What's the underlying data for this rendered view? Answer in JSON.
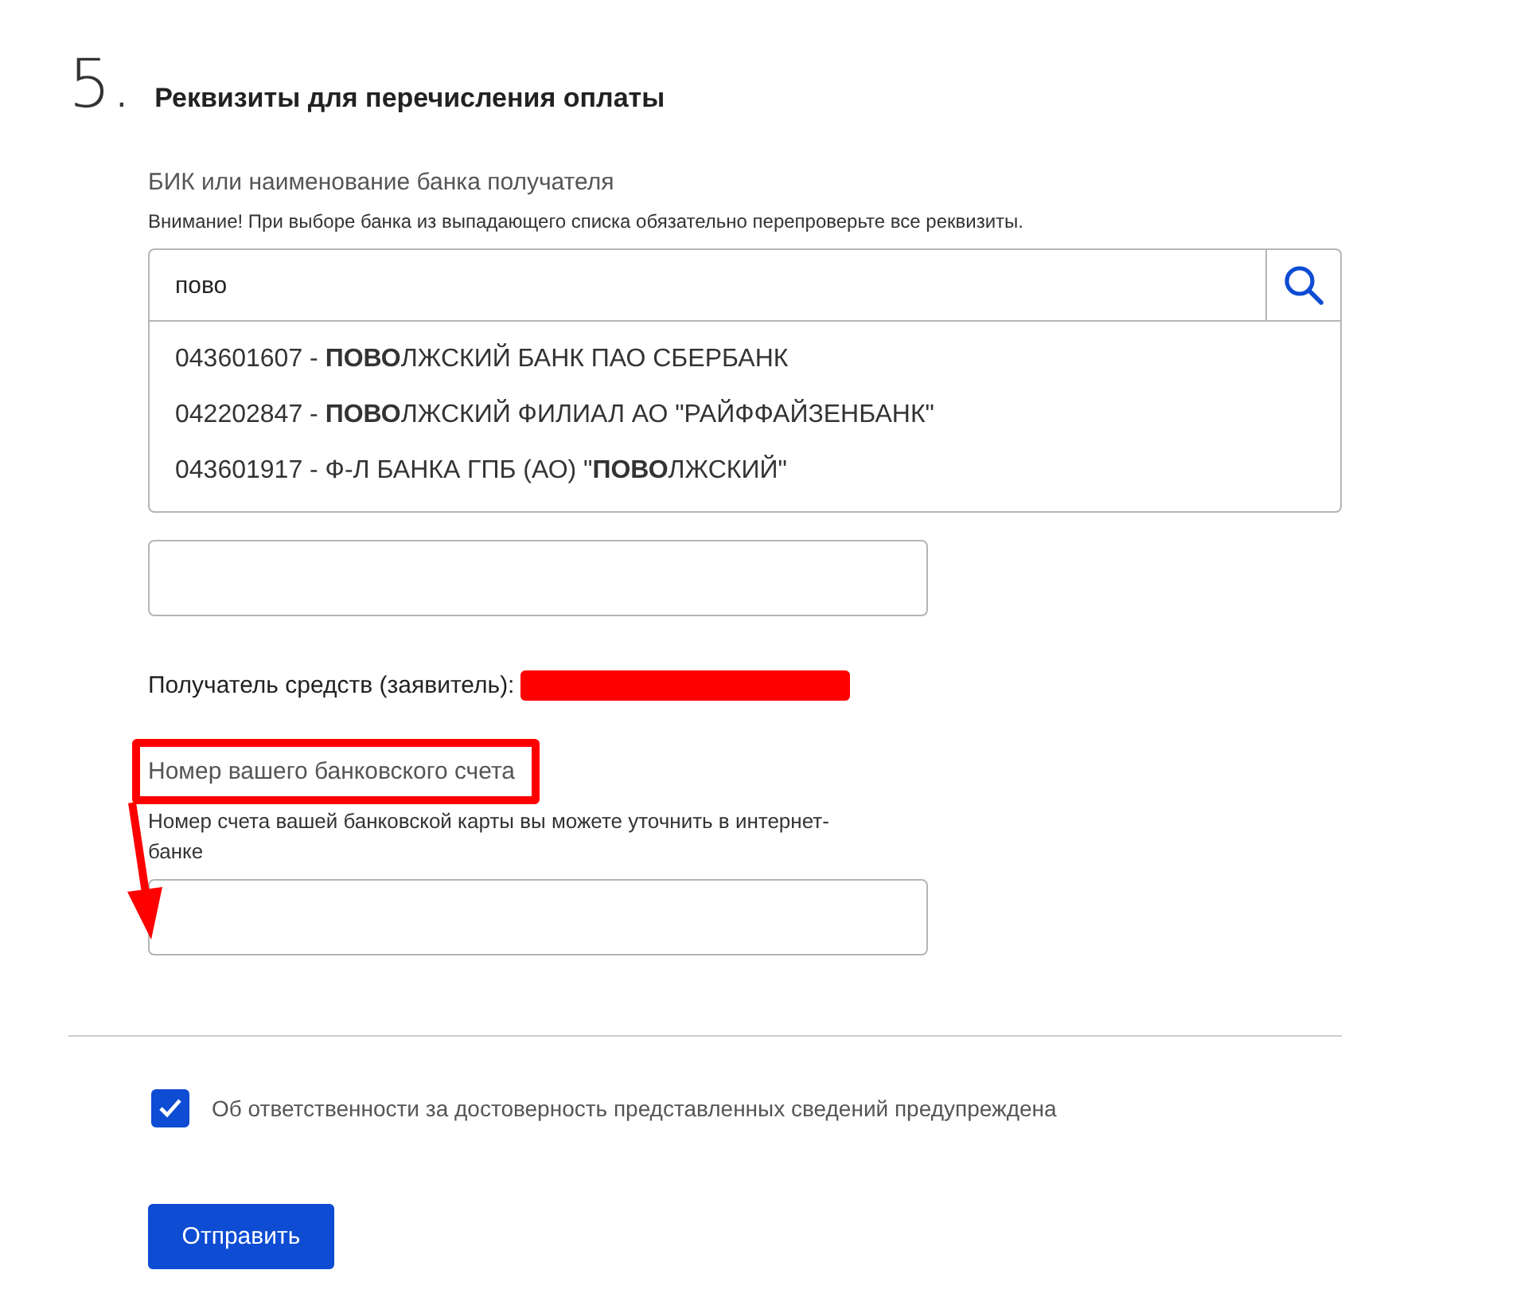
{
  "section": {
    "number": "5.",
    "title": "Реквизиты для перечисления оплаты"
  },
  "bank_field": {
    "label": "БИК или наименование банка получателя",
    "note": "Внимание! При выборе банка из выпадающего списка обязательно перепроверьте все реквизиты.",
    "value": "пово",
    "suggestions": [
      {
        "text": "043601607 - **ПОВО**ЛЖСКИЙ БАНК ПАО СБЕРБАНК"
      },
      {
        "text": "042202847 - **ПОВО**ЛЖСКИЙ ФИЛИАЛ АО \"РАЙФФАЙЗЕНБАНК\""
      },
      {
        "text": "043601917 - Ф-Л БАНКА ГПБ (АО) \"**ПОВО**ЛЖСКИЙ\""
      }
    ]
  },
  "recipient": {
    "label": "Получатель средств (заявитель):"
  },
  "account": {
    "label": "Номер вашего банковского счета",
    "note": "Номер счета вашей банковской карты вы можете уточнить в интернет-банке"
  },
  "agreement": {
    "label": "Об ответственности за достоверность представленных сведений предупреждена",
    "checked": true
  },
  "submit": {
    "label": "Отправить"
  }
}
